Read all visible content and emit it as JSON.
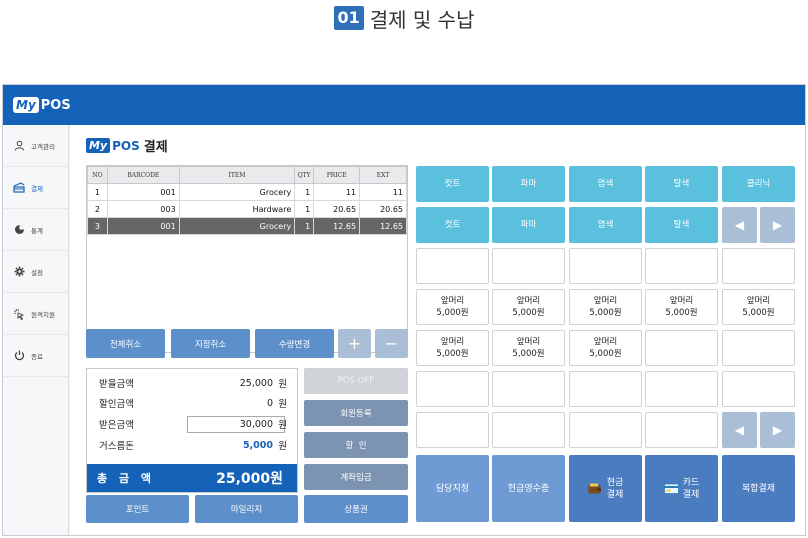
{
  "heading": {
    "number": "01",
    "title": "결제 및 수납"
  },
  "app": {
    "logo_my": "My",
    "logo_pos": "POS"
  },
  "sidebar": {
    "items": [
      {
        "label": "고객관리",
        "icon": "user-icon"
      },
      {
        "label": "결제",
        "icon": "card-payment-icon"
      },
      {
        "label": "통계",
        "icon": "pie-chart-icon"
      },
      {
        "label": "설정",
        "icon": "gear-icon"
      },
      {
        "label": "원격지원",
        "icon": "remote-support-icon"
      },
      {
        "label": "종료",
        "icon": "power-icon"
      }
    ]
  },
  "main": {
    "title_my": "My",
    "title_pos": "POS",
    "title_label": "결제"
  },
  "table": {
    "columns": [
      "NO",
      "BARCODE",
      "ITEM",
      "QTY",
      "PRICE",
      "EXT"
    ],
    "rows": [
      {
        "no": "1",
        "barcode": "001",
        "item": "Grocery",
        "qty": "1",
        "price": "11",
        "ext": "11"
      },
      {
        "no": "2",
        "barcode": "003",
        "item": "Hardware",
        "qty": "1",
        "price": "20.65",
        "ext": "20.65"
      },
      {
        "no": "3",
        "barcode": "001",
        "item": "Grocery",
        "qty": "1",
        "price": "12.65",
        "ext": "12.65"
      }
    ]
  },
  "actions": {
    "cancel_all": "전체취소",
    "cancel_selected": "지정취소",
    "change_qty": "수량변경",
    "plus": "+",
    "minus": "−"
  },
  "summary": {
    "receivable_label": "받을금액",
    "receivable_value": "25,000",
    "discount_label": "할인금액",
    "discount_value": "0",
    "received_label": "받은금액",
    "received_value": "30,000",
    "change_label": "거스름돈",
    "change_value": "5,000",
    "unit": "원",
    "total_label": "총 금 액",
    "total_value": "25,000원"
  },
  "side_buttons": {
    "pos_off": "POS OFF",
    "member_register": "회원등록",
    "discount": "할  인",
    "account_deposit": "계좌입금"
  },
  "bottom_buttons": {
    "point": "포인트",
    "mileage": "마일리지",
    "gift_card": "상품권"
  },
  "keypad": {
    "row1": [
      "컷트",
      "파마",
      "염색",
      "탈색",
      "클리닉"
    ],
    "row2": [
      "컷트",
      "파마",
      "염색",
      "탈색"
    ],
    "front_hair": [
      "앞머리",
      "5,000원"
    ],
    "assign_staff": "담당지정",
    "cash_receipt": "현금영수증",
    "cash_pay_1": "현금",
    "cash_pay_2": "결제",
    "card_pay_1": "카드",
    "card_pay_2": "결제",
    "combo_pay": "복합결제",
    "arrow_left": "◀",
    "arrow_right": "▶"
  },
  "colors": {
    "brand_blue": "#1563b8",
    "button_blue": "#5d8fcb",
    "cyan_key": "#5bc0de",
    "disabled_gray": "#cfd2d6",
    "slate_button": "#7d93b2"
  }
}
